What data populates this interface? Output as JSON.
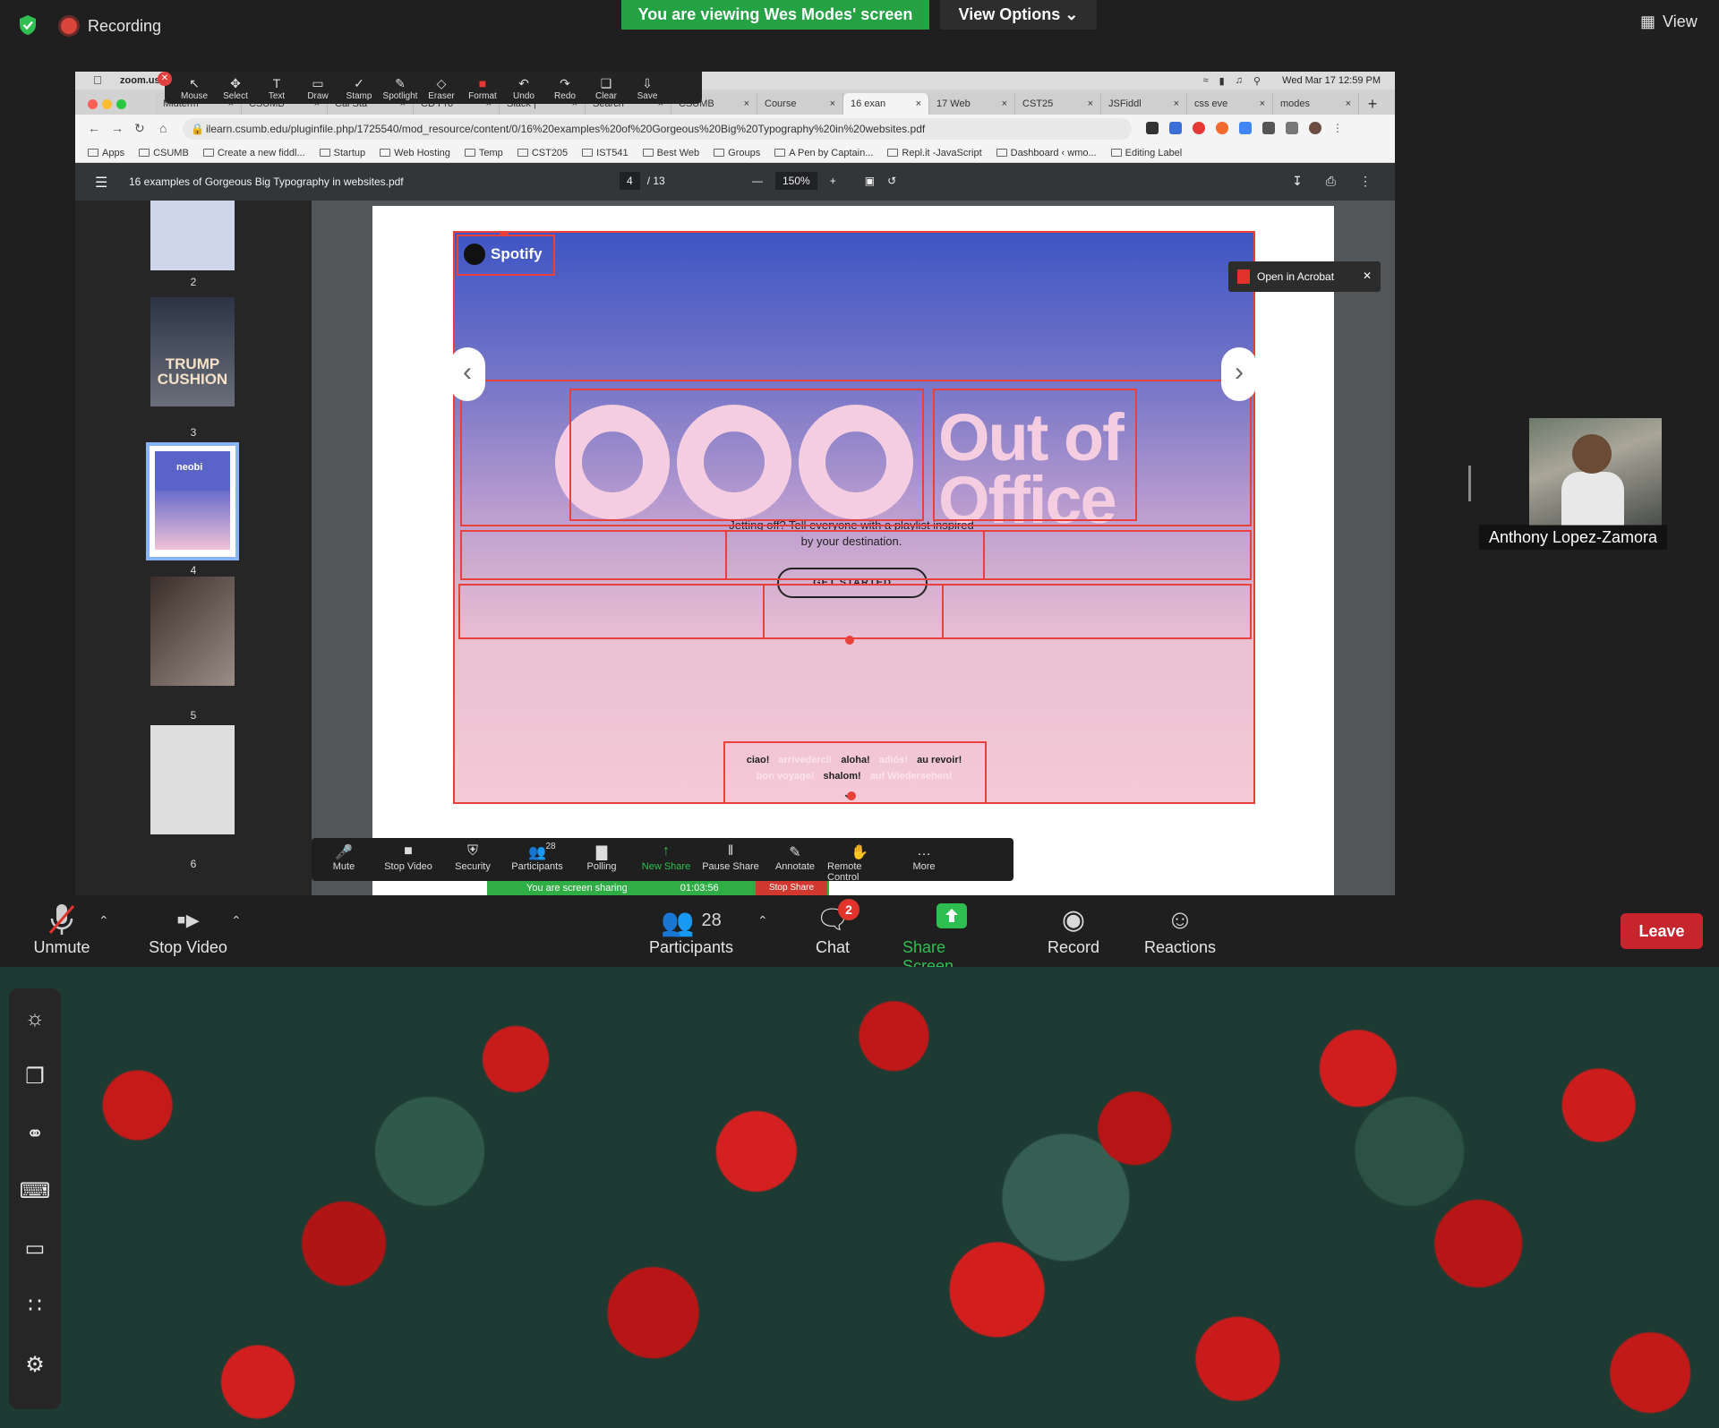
{
  "zoom": {
    "recording_label": "Recording",
    "viewing_banner": "You are viewing Wes Modes' screen",
    "view_options": "View Options",
    "view_label": "View"
  },
  "mac": {
    "app_name": "zoom.us",
    "clock": "Wed Mar 17  12:59 PM"
  },
  "annotation_tools": [
    {
      "label": "Mouse",
      "icon": "arrow-pointer-icon"
    },
    {
      "label": "Select",
      "icon": "move-icon"
    },
    {
      "label": "Text",
      "icon": "text-icon"
    },
    {
      "label": "Draw",
      "icon": "rectangle-icon"
    },
    {
      "label": "Stamp",
      "icon": "checkmark-icon"
    },
    {
      "label": "Spotlight",
      "icon": "spotlight-icon"
    },
    {
      "label": "Eraser",
      "icon": "eraser-icon"
    },
    {
      "label": "Format",
      "icon": "format-color-icon"
    },
    {
      "label": "Undo",
      "icon": "undo-icon"
    },
    {
      "label": "Redo",
      "icon": "redo-icon"
    },
    {
      "label": "Clear",
      "icon": "trash-icon"
    },
    {
      "label": "Save",
      "icon": "save-icon"
    }
  ],
  "browser": {
    "tabs": [
      "Midterm",
      "CSUMB",
      "Cal Sta",
      "CD Pro",
      "Slack |",
      "Search",
      "CSUMB",
      "Course",
      "16 exan",
      "17 Web",
      "CST25",
      "JSFiddl",
      "css eve",
      "modes"
    ],
    "active_tab_index": 8,
    "url": "ilearn.csumb.edu/pluginfile.php/1725540/mod_resource/content/0/16%20examples%20of%20Gorgeous%20Big%20Typography%20in%20websites.pdf",
    "bookmarks": [
      "Apps",
      "CSUMB",
      "Create a new fiddl...",
      "Startup",
      "Web Hosting",
      "Temp",
      "CST205",
      "IST541",
      "Best Web",
      "Groups",
      "A Pen by Captain...",
      "Repl.it -JavaScript",
      "Dashboard ‹ wmo...",
      "Editing Label"
    ]
  },
  "pdf": {
    "title": "16 examples of Gorgeous Big Typography in websites.pdf",
    "current_page": "4",
    "total_pages": "/ 13",
    "zoom": "150%",
    "thumb_numbers": [
      "2",
      "3",
      "4",
      "5",
      "6"
    ],
    "thumb3_text": "TRUMP CUSHION",
    "thumb4_text": "neobi",
    "open_in_acrobat": "Open in Acrobat"
  },
  "spotify": {
    "logo": "Spotify",
    "headline_line1": "Out of",
    "headline_line2": "Office",
    "tagline": "Jetting off? Tell everyone with a playlist inspired by your destination.",
    "cta": "GET STARTED",
    "greetings_line1": [
      {
        "text": "ciao!",
        "faint": false
      },
      {
        "text": "arrivederci!",
        "faint": true
      },
      {
        "text": "aloha!",
        "faint": false
      },
      {
        "text": "adiós!",
        "faint": true
      },
      {
        "text": "au revoir!",
        "faint": false
      }
    ],
    "greetings_line2": [
      {
        "text": "bon voyage!",
        "faint": true
      },
      {
        "text": "shalom!",
        "faint": false
      },
      {
        "text": "auf Wiedersehen!",
        "faint": true
      }
    ]
  },
  "share_toolbar": {
    "buttons": [
      "Mute",
      "Stop Video",
      "Security",
      "Participants",
      "Polling",
      "New Share",
      "Pause Share",
      "Annotate",
      "Remote Control",
      "More"
    ],
    "participant_count": "28",
    "sharing_text": "You are screen sharing",
    "timer": "01:03:56",
    "stop_share": "Stop Share"
  },
  "participant": {
    "name": "Anthony Lopez-Zamora"
  },
  "bottom_bar": {
    "unmute": "Unmute",
    "stop_video": "Stop Video",
    "participants": "Participants",
    "participants_count": "28",
    "chat": "Chat",
    "chat_badge": "2",
    "share_screen": "Share Screen",
    "record": "Record",
    "reactions": "Reactions",
    "leave": "Leave"
  },
  "dock_icons": [
    "brightness-icon",
    "windows-icon",
    "link-icon",
    "keyboard-icon",
    "laptop-icon",
    "apps-grid-icon",
    "gear-icon"
  ],
  "colors": {
    "zoom_green": "#25a244",
    "leave_red": "#c7252d",
    "annotation_red": "#e8413b",
    "spotify_ooo_pink": "#f4cde1"
  }
}
